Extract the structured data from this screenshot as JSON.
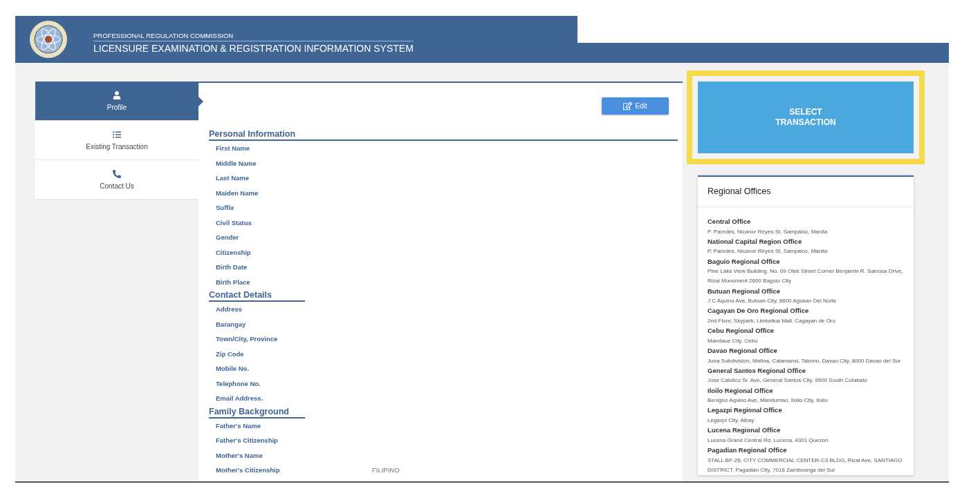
{
  "header": {
    "agency": "PROFESSIONAL REGULATION COMMISSION",
    "system": "LICENSURE EXAMINATION & REGISTRATION INFORMATION SYSTEM"
  },
  "sidebar": {
    "items": [
      {
        "label": "Profile",
        "selected": true
      },
      {
        "label": "Existing Transaction",
        "selected": false
      },
      {
        "label": "Contact Us",
        "selected": false
      }
    ]
  },
  "profile": {
    "edit_button": "Edit",
    "sections": [
      {
        "title": "Personal Information",
        "wide": true,
        "fields": [
          {
            "label": "First Name"
          },
          {
            "label": "Middle Name"
          },
          {
            "label": "Last Name"
          },
          {
            "label": "Maiden Name"
          },
          {
            "label": "Suffix"
          },
          {
            "label": "Civil Status"
          },
          {
            "label": "Gender"
          },
          {
            "label": "Citizenship"
          },
          {
            "label": "Birth Date"
          },
          {
            "label": "Birth Place"
          }
        ]
      },
      {
        "title": "Contact Details",
        "wide": false,
        "fields": [
          {
            "label": "Address"
          },
          {
            "label": "Barangay"
          },
          {
            "label": "Town/City, Province"
          },
          {
            "label": "Zip Code"
          },
          {
            "label": "Mobile No."
          },
          {
            "label": "Telephone No."
          },
          {
            "label": "Email Address."
          }
        ]
      },
      {
        "title": "Family Background",
        "wide": false,
        "fields": [
          {
            "label": "Father's Name"
          },
          {
            "label": "Father's Citizenship"
          },
          {
            "label": "Mother's Name"
          },
          {
            "label": "Mother's Citizenship",
            "value": "FILIPINO"
          }
        ]
      }
    ]
  },
  "select_transaction": {
    "lines": [
      "SELECT",
      "TRANSACTION"
    ],
    "highlighted": true
  },
  "regional_offices": {
    "title": "Regional Offices",
    "offices": [
      {
        "name": "Central Office",
        "address": "P. Paredes, Nicanor Reyes St, Sampaloc, Manila"
      },
      {
        "name": "National Capital Region Office",
        "address": "P. Paredes, Nicanor Reyes St, Sampaloc, Manila"
      },
      {
        "name": "Baguio Regional Office",
        "address": "Pine Lake View Building, No. 09 Otek Street Corner Benjamin R. Salvosa Drive, Rizal Monument 2600 Baguio City"
      },
      {
        "name": "Butuan Regional Office",
        "address": "J C Aquino Ave, Butuan City, 8600 Agusan Del Norte"
      },
      {
        "name": "Cagayan De Oro Regional Office",
        "address": "2nd Floor, Skypark, Limketkai Mall, Cagayan de Oro"
      },
      {
        "name": "Cebu Regional Office",
        "address": "Mandaue City, Cebu"
      },
      {
        "name": "Davao Regional Office",
        "address": "Juna Subdivision, Matina, Calamansi, Talomo, Davao City, 8000 Davao del Sur"
      },
      {
        "name": "General Santos Regional Office",
        "address": "Jose Catolico Sr. Ave, General Santos City, 9500 South Cotabato"
      },
      {
        "name": "Iloilo Regional Office",
        "address": "Benigno Aquino Ave, Mandurriao, Iloilo City, Iloilo"
      },
      {
        "name": "Legazpi Regional Office",
        "address": "Legazpi City, Albay"
      },
      {
        "name": "Lucena Regional Office",
        "address": "Lucena Grand Central Rd, Lucena, 4301 Quezon"
      },
      {
        "name": "Pagadian Regional Office",
        "address": "STALL BF-26, CITY COMMERCIAL CENTER-C3 BLDG, Rizal Ave, SANTIAGO DISTRICT, Pagadian City, 7016 Zamboanga del Sur"
      }
    ]
  }
}
